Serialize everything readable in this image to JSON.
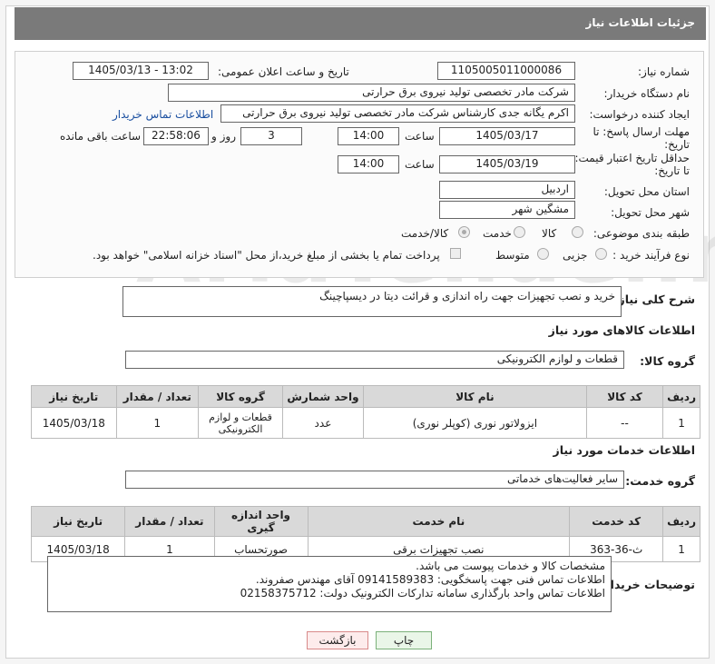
{
  "header": {
    "title": "جزئیات اطلاعات نیاز"
  },
  "form": {
    "need_number_label": "شماره نیاز:",
    "need_number": "1105005011000086",
    "announce_label": "تاریخ و ساعت اعلان عمومی:",
    "announce_value": "1405/03/13 - 13:02",
    "buyer_org_label": "نام دستگاه خریدار:",
    "buyer_org": "شرکت مادر تخصصی تولید نیروی برق حرارتی",
    "creator_label": "ایجاد کننده درخواست:",
    "creator": "اکرم یگانه جدی کارشناس شرکت مادر تخصصی تولید نیروی برق حرارتی",
    "contact_link": "اطلاعات تماس خریدار",
    "deadline_label_1": "مهلت ارسال پاسخ: تا",
    "deadline_label_2": "تاریخ:",
    "deadline_date": "1405/03/17",
    "hour_label": "ساعت",
    "deadline_time": "14:00",
    "days_value": "3",
    "days_label": "روز و",
    "remaining_time": "22:58:06",
    "remaining_label": "ساعت باقی مانده",
    "validity_label_1": "حداقل تاریخ اعتبار قیمت:",
    "validity_label_2": "تا تاریخ:",
    "validity_date": "1405/03/19",
    "validity_time": "14:00",
    "province_label": "استان محل تحویل:",
    "province": "اردبیل",
    "city_label": "شهر محل تحویل:",
    "city": "مشگین شهر",
    "category_label": "طبقه بندی موضوعی:",
    "category_options": [
      "کالا",
      "خدمت",
      "کالا/خدمت"
    ],
    "process_label": "نوع فرآیند خرید :",
    "process_options": [
      "جزیی",
      "متوسط"
    ],
    "payment_note": "پرداخت تمام یا بخشی از مبلغ خرید،از محل \"اسناد خزانه اسلامی\" خواهد بود."
  },
  "description": {
    "label": "شرح کلی نیاز:",
    "text": "خرید و نصب تجهیزات جهت راه اندازی و قرائت دیتا در دیسپاچینگ"
  },
  "goods": {
    "section_title": "اطلاعات کالاهای مورد نیاز",
    "group_label": "گروه کالا:",
    "group_value": "قطعات و لوازم الکترونیکی",
    "columns": [
      "ردیف",
      "کد کالا",
      "نام کالا",
      "واحد شمارش",
      "گروه کالا",
      "تعداد / مقدار",
      "تاریخ نیاز"
    ],
    "rows": [
      {
        "row": "1",
        "code": "--",
        "name": "ایزولاتور نوری (کوپلر نوری)",
        "unit": "عدد",
        "group": "قطعات و لوازم الکترونیکی",
        "qty": "1",
        "date": "1405/03/18"
      }
    ]
  },
  "services": {
    "section_title": "اطلاعات خدمات مورد نیاز",
    "group_label": "گروه خدمت:",
    "group_value": "سایر فعالیت‌های خدماتی",
    "columns": [
      "ردیف",
      "کد خدمت",
      "نام خدمت",
      "واحد اندازه گیری",
      "تعداد / مقدار",
      "تاریخ نیاز"
    ],
    "rows": [
      {
        "row": "1",
        "code": "ث-36-363",
        "name": "نصب تجهیزات برقی",
        "unit": "صورتحساب",
        "qty": "1",
        "date": "1405/03/18"
      }
    ]
  },
  "buyer_notes": {
    "label": "توضیحات خریدار:",
    "line1": "مشخصات کالا و خدمات پیوست می باشد.",
    "line2": "اطلاعات تماس فنی جهت پاسخگویی: 09141589383 آقای مهندس صفروند.",
    "line3": "اطلاعات تماس واحد بارگذاری سامانه تدارکات الکترونیک دولت: 02158375712"
  },
  "buttons": {
    "print": "چاپ",
    "back": "بازگشت"
  },
  "watermark": "AriaTender.net"
}
